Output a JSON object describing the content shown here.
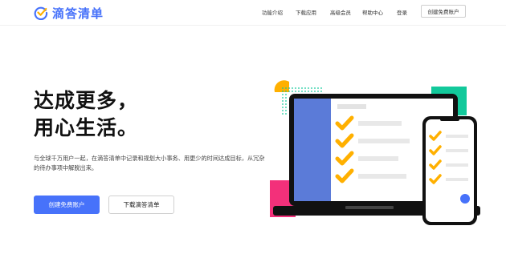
{
  "header": {
    "brand": "滴答清单",
    "nav": [
      "功能介绍",
      "下载应用",
      "高级会员",
      "帮助中心",
      "登录"
    ],
    "cta": "创建免费账户"
  },
  "hero": {
    "headline_line1": "达成更多，",
    "headline_line2": "用心生活。",
    "subtitle": "与全球千万用户一起，在滴答清单中记录和规划大小事务、用更少的时间达成目标，从冗杂的待办事项中解脱出来。",
    "primary_button": "创建免费账户",
    "secondary_button": "下载滴答清单"
  },
  "colors": {
    "brand": "#4772fa",
    "accent_yellow": "#ffb000",
    "accent_teal": "#12c99b",
    "accent_pink": "#f3307a"
  },
  "icons": {
    "logo": "check-circle-icon",
    "illustration": "laptop-phone-checklist-illustration"
  }
}
